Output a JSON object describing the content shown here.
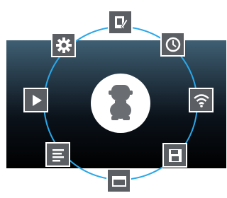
{
  "launcher": {
    "accent": "#2aa7e8",
    "tile_color": "#5b5f63",
    "center": {
      "icon": "robot-icon"
    },
    "items": [
      {
        "id": "notes",
        "icon": "pencil-note-icon"
      },
      {
        "id": "clock",
        "icon": "clock-icon"
      },
      {
        "id": "wifi",
        "icon": "wifi-icon"
      },
      {
        "id": "save",
        "icon": "floppy-disk-icon"
      },
      {
        "id": "folder",
        "icon": "folder-icon"
      },
      {
        "id": "document",
        "icon": "document-lines-icon"
      },
      {
        "id": "play",
        "icon": "play-icon"
      },
      {
        "id": "settings",
        "icon": "gear-icon"
      }
    ]
  }
}
